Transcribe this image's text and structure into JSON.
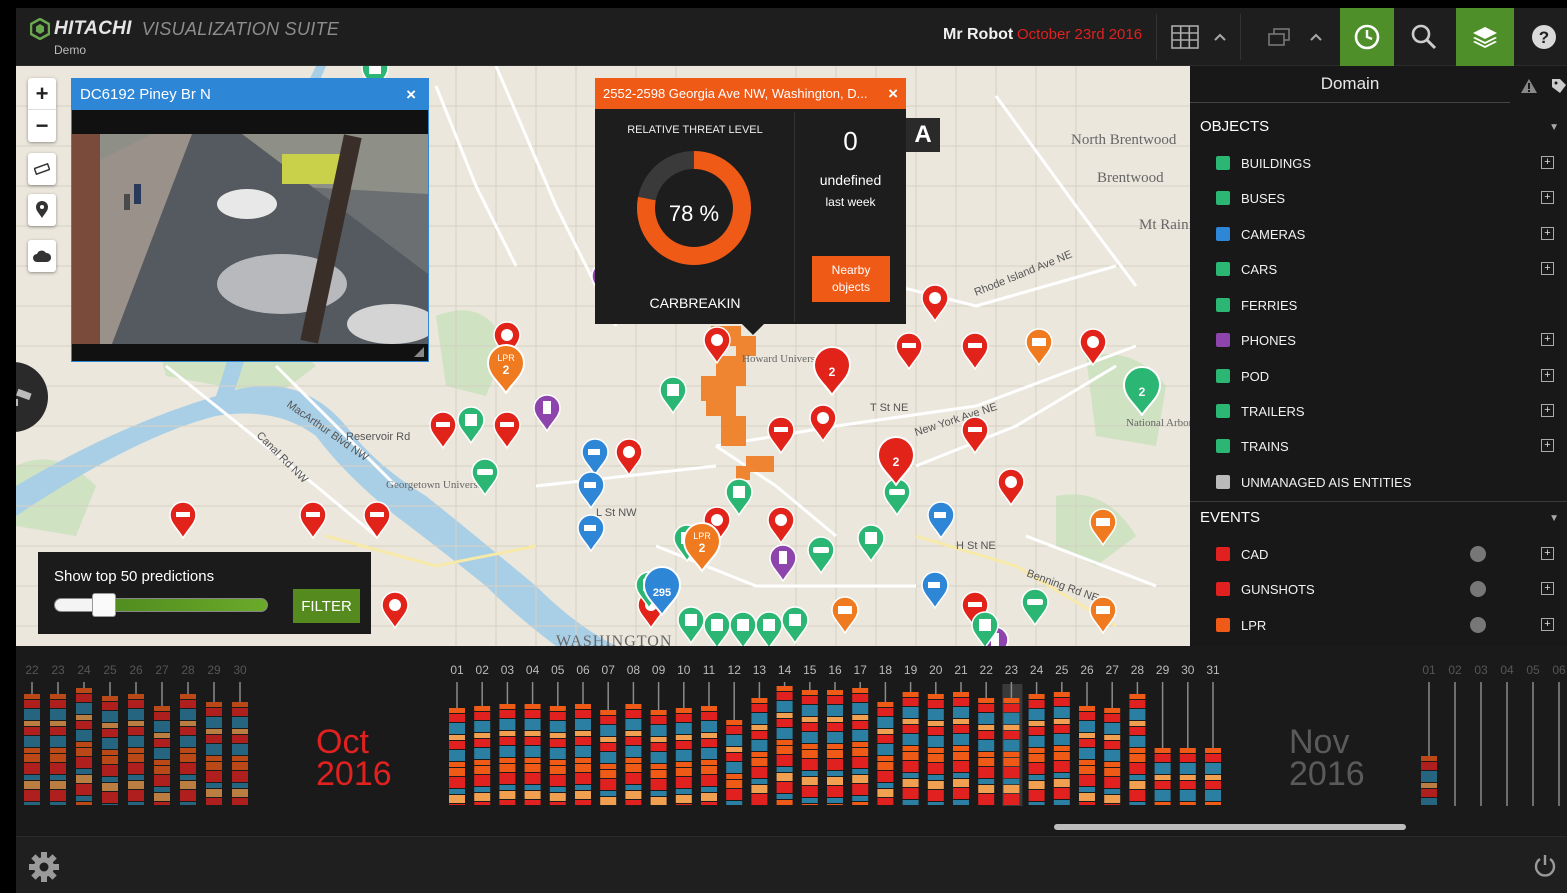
{
  "app": {
    "brand": "HITACHI",
    "suite": "VISUALIZATION SUITE",
    "subtitle": "Demo"
  },
  "header": {
    "user": "Mr Robot",
    "date": "October 23rd 2016"
  },
  "toolbar_icons": [
    "grid-icon",
    "chevron-up-icon",
    "windows-icon",
    "chevron-up-icon",
    "clock-icon",
    "search-icon",
    "layers-icon",
    "help-icon"
  ],
  "colors": {
    "accent_green": "#4e8f2a",
    "alert_red": "#e0211f",
    "threat_orange": "#f05a17",
    "camera_blue": "#2e86d6"
  },
  "camera_popup": {
    "title": "DC6192 Piney Br N",
    "close": "×"
  },
  "threat_popup": {
    "address": "2552-2598 Georgia Ave NW, Washington, D...",
    "close": "×",
    "label": "RELATIVE THREAT LEVEL",
    "percent_text": "78 %",
    "percent": 78,
    "category": "CARBREAKIN",
    "count": "0",
    "count_label": "undefined",
    "period": "last week",
    "nearby_line1": "Nearby",
    "nearby_line2": "objects"
  },
  "map_badge": "A",
  "map_labels": {
    "north_brentwood": "North Brentwood",
    "brentwood": "Brentwood",
    "mt_rainier": "Mt Rainier",
    "washington": "WASHINGTON",
    "georgetown": "Georgetown University",
    "national_arboretum": "National Arboretum",
    "howard": "Howard University",
    "reservoir": "Reservoir Rd",
    "rhode_island": "Rhode Island Ave NE",
    "ny_ave": "New York Ave NE",
    "benning": "Benning Rd NE",
    "t_st": "T St NE",
    "h_st": "H St NE",
    "l_st": "L St NW",
    "canal_rd": "Canal Rd NW",
    "macarthur": "MacArthur Blvd NW"
  },
  "clusters": [
    {
      "label": "LPR",
      "count": "2"
    },
    {
      "label": "LPR",
      "count": "2"
    },
    {
      "label": "",
      "count": "2"
    },
    {
      "label": "",
      "count": "2"
    },
    {
      "label": "",
      "count": "2"
    },
    {
      "label": "",
      "count": "295"
    }
  ],
  "predictions": {
    "label": "Show top 50 predictions",
    "value": 50,
    "slider_fraction": 0.2,
    "filter": "FILTER"
  },
  "panel": {
    "domain": "Domain",
    "objects_header": "OBJECTS",
    "objects": [
      {
        "label": "BUILDINGS",
        "color": "#2bb673",
        "plus": "+"
      },
      {
        "label": "BUSES",
        "color": "#2bb673",
        "plus": "+"
      },
      {
        "label": "CAMERAS",
        "color": "#2e86d6",
        "plus": "+"
      },
      {
        "label": "CARS",
        "color": "#2bb673",
        "plus": "+"
      },
      {
        "label": "FERRIES",
        "color": "#2bb673",
        "plus": ""
      },
      {
        "label": "PHONES",
        "color": "#8e44ad",
        "plus": "+"
      },
      {
        "label": "POD",
        "color": "#2bb673",
        "plus": "+"
      },
      {
        "label": "TRAILERS",
        "color": "#2bb673",
        "plus": "+"
      },
      {
        "label": "TRAINS",
        "color": "#2bb673",
        "plus": "+"
      },
      {
        "label": "UNMANAGED AIS ENTITIES",
        "color": "#bbbbbb",
        "plus": ""
      }
    ],
    "events_header": "EVENTS",
    "events": [
      {
        "label": "CAD",
        "color": "#e0211f",
        "plus": "+"
      },
      {
        "label": "GUNSHOTS",
        "color": "#e0211f",
        "plus": "+"
      },
      {
        "label": "LPR",
        "color": "#f05a17",
        "plus": "+"
      }
    ]
  },
  "timeline": {
    "sep_days": [
      "22",
      "23",
      "24",
      "25",
      "26",
      "27",
      "28",
      "29",
      "30"
    ],
    "oct_days": [
      "01",
      "02",
      "03",
      "04",
      "05",
      "06",
      "07",
      "08",
      "09",
      "10",
      "11",
      "12",
      "13",
      "14",
      "15",
      "16",
      "17",
      "18",
      "19",
      "20",
      "21",
      "22",
      "23",
      "24",
      "25",
      "26",
      "27",
      "28",
      "29",
      "30",
      "31"
    ],
    "nov_days": [
      "01",
      "02",
      "03",
      "04",
      "05",
      "06"
    ],
    "oct_label_1": "Oct",
    "oct_label_2": "2016",
    "nov_label_1": "Nov",
    "nov_label_2": "2016",
    "sep_heights": [
      112,
      112,
      118,
      110,
      112,
      100,
      112,
      104,
      104
    ],
    "oct_heights": [
      98,
      100,
      102,
      102,
      100,
      102,
      96,
      102,
      96,
      98,
      100,
      86,
      108,
      120,
      116,
      116,
      118,
      104,
      114,
      112,
      114,
      108,
      108,
      112,
      114,
      100,
      98,
      112,
      58,
      58,
      58
    ],
    "nov_heights": [
      50,
      0,
      0,
      0,
      0,
      0
    ],
    "selected_day": "23"
  },
  "bottom": {
    "settings_icon": "gear-icon",
    "power_icon": "power-icon"
  }
}
